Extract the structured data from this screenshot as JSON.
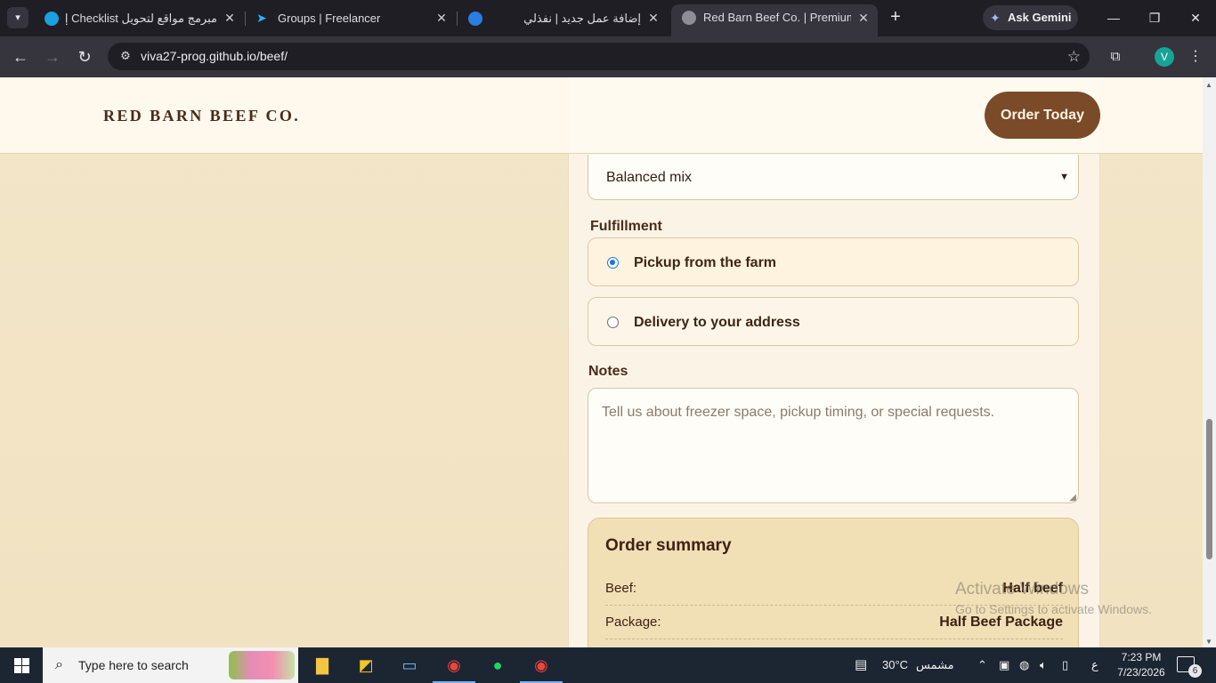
{
  "browser": {
    "tabs": [
      {
        "label": "مبرمج مواقع لتحويل Checklist إل",
        "close": "✕"
      },
      {
        "label": "Groups | Freelancer",
        "close": "✕"
      },
      {
        "label": "إضافة عمل جديد | نفذلي",
        "close": "✕"
      },
      {
        "label": "Red Barn Beef Co. | Premium Fa",
        "close": "✕"
      }
    ],
    "new_tab": "+",
    "ask_gemini": "Ask Gemini",
    "url": "viva27-prog.github.io/beef/",
    "profile_initial": "V",
    "window_controls": {
      "minimize": "—",
      "restore": "❐",
      "close": "✕"
    }
  },
  "page": {
    "brand": "RED BARN BEEF CO.",
    "order_button": "Order Today",
    "select_value": "Balanced mix",
    "fulfillment_label": "Fulfillment",
    "fulfillment_options": [
      {
        "label": "Pickup from the farm",
        "selected": true
      },
      {
        "label": "Delivery to your address",
        "selected": false
      }
    ],
    "notes_label": "Notes",
    "notes_placeholder": "Tell us about freezer space, pickup timing, or special requests.",
    "summary": {
      "title": "Order summary",
      "rows": [
        {
          "key": "Beef:",
          "value": "Half beef"
        },
        {
          "key": "Package:",
          "value": "Half Beef Package"
        }
      ]
    },
    "os_watermark": {
      "line1": "Activate Windows",
      "line2": "Go to Settings to activate Windows."
    }
  },
  "taskbar": {
    "search_placeholder": "Type here to search",
    "weather_temp": "30°C",
    "weather_text": "مشمس",
    "ime": "ع",
    "time": "7:23 PM",
    "date": "7/23/2026",
    "notification_count": "6"
  },
  "colors": {
    "page_bg": "#f3e6c8",
    "brand_brown": "#7b4a28",
    "summary_bg": "#f1e0b6",
    "radio_accent": "#1a73e8",
    "taskbar_bg": "#1c2532",
    "chrome_dark": "#1f1e24"
  }
}
